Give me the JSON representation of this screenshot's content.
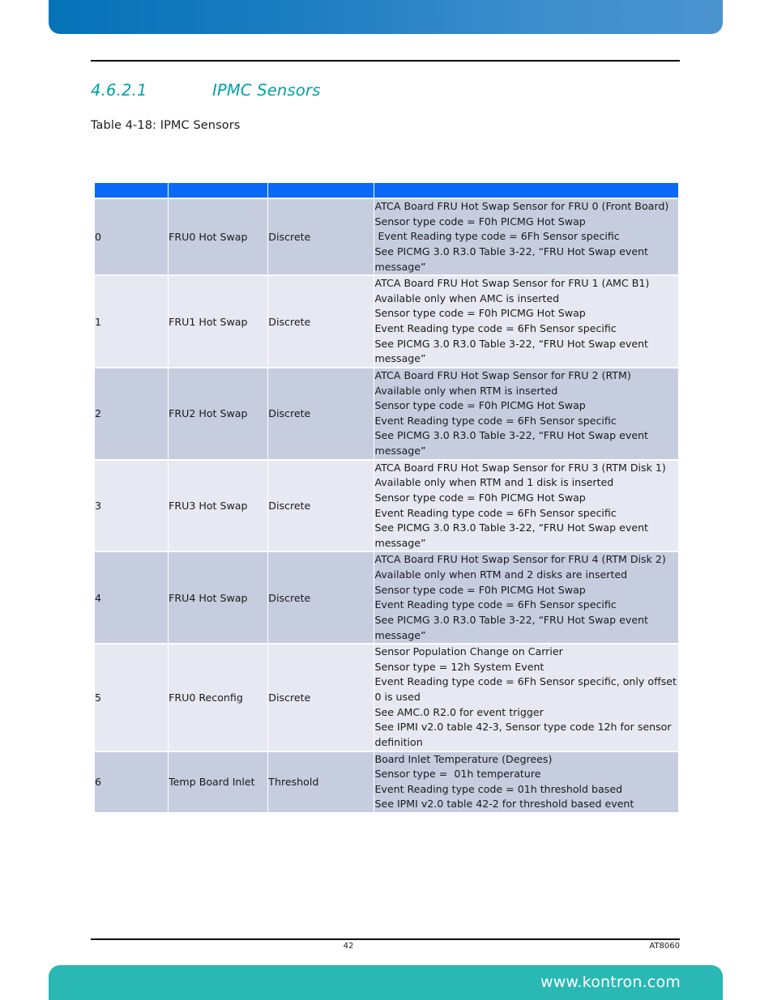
{
  "page": {
    "accent_blue": "#0a69f7",
    "banner_blue": "#1b7cc0",
    "banner_teal": "#2ab8b4",
    "heading_teal": "#00a0a8",
    "row_dark": "#c6cddf",
    "row_light": "#e6e9f1"
  },
  "section": {
    "number": "4.6.2.1",
    "title": "IPMC Sensors"
  },
  "table_caption": "Table 4-18: IPMC Sensors",
  "table": {
    "headers": [
      "",
      "",
      "",
      ""
    ],
    "rows": [
      {
        "num": "0",
        "name": "FRU0 Hot Swap",
        "type": "Discrete",
        "description": "ATCA Board FRU Hot Swap Sensor for FRU 0 (Front Board)\nSensor type code = F0h PICMG Hot Swap\n Event Reading type code = 6Fh Sensor specific\nSee PICMG 3.0 R3.0 Table 3-22, “FRU Hot Swap event message”"
      },
      {
        "num": "1",
        "name": "FRU1 Hot Swap",
        "type": "Discrete",
        "description": "ATCA Board FRU Hot Swap Sensor for FRU 1 (AMC B1)\nAvailable only when AMC is inserted\nSensor type code = F0h PICMG Hot Swap\nEvent Reading type code = 6Fh Sensor specific\nSee PICMG 3.0 R3.0 Table 3-22, “FRU Hot Swap event message”"
      },
      {
        "num": "2",
        "name": "FRU2 Hot Swap",
        "type": "Discrete",
        "description": "ATCA Board FRU Hot Swap Sensor for FRU 2 (RTM)\nAvailable only when RTM is inserted\nSensor type code = F0h PICMG Hot Swap\nEvent Reading type code = 6Fh Sensor specific\nSee PICMG 3.0 R3.0 Table 3-22, “FRU Hot Swap event message”"
      },
      {
        "num": "3",
        "name": "FRU3 Hot Swap",
        "type": "Discrete",
        "description": "ATCA Board FRU Hot Swap Sensor for FRU 3 (RTM Disk 1)\nAvailable only when RTM and 1 disk is inserted\nSensor type code = F0h PICMG Hot Swap\nEvent Reading type code = 6Fh Sensor specific\nSee PICMG 3.0 R3.0 Table 3-22, “FRU Hot Swap event message”"
      },
      {
        "num": "4",
        "name": "FRU4 Hot Swap",
        "type": "Discrete",
        "description": "ATCA Board FRU Hot Swap Sensor for FRU 4 (RTM Disk 2)\nAvailable only when RTM and 2 disks are inserted\nSensor type code = F0h PICMG Hot Swap\nEvent Reading type code = 6Fh Sensor specific\nSee PICMG 3.0 R3.0 Table 3-22, “FRU Hot Swap event message”"
      },
      {
        "num": "5",
        "name": "FRU0 Reconfig",
        "type": "Discrete",
        "description": "Sensor Population Change on Carrier\nSensor type = 12h System Event\nEvent Reading type code = 6Fh Sensor specific, only offset 0 is used\nSee AMC.0 R2.0 for event trigger\nSee IPMI v2.0 table 42-3, Sensor type code 12h for sensor definition"
      },
      {
        "num": "6",
        "name": "Temp Board Inlet",
        "type": "Threshold",
        "description": "Board Inlet Temperature (Degrees)\nSensor type =  01h temperature\nEvent Reading type code = 01h threshold based\nSee IPMI v2.0 table 42-2 for threshold based event"
      }
    ]
  },
  "footer": {
    "page_number": "42",
    "document_code": "AT8060",
    "website": "www.kontron.com"
  }
}
